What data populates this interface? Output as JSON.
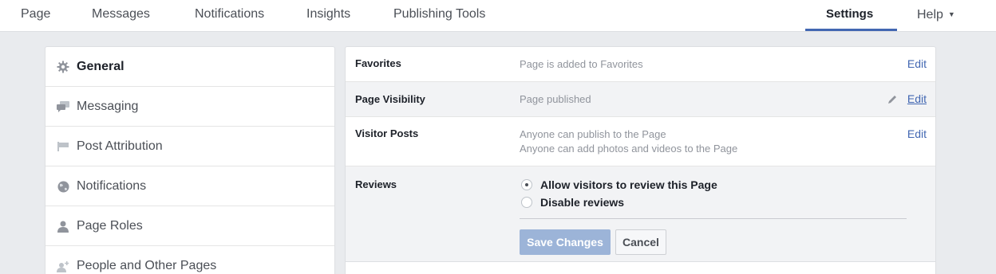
{
  "topnav": {
    "items": [
      "Page",
      "Messages",
      "Notifications",
      "Insights",
      "Publishing Tools"
    ],
    "settings": "Settings",
    "help": "Help",
    "help_caret": "▼",
    "active": "Settings"
  },
  "sidebar": {
    "items": [
      {
        "label": "General",
        "icon": "gear-icon",
        "active": true
      },
      {
        "label": "Messaging",
        "icon": "chat-bubbles-icon"
      },
      {
        "label": "Post Attribution",
        "icon": "flag-icon"
      },
      {
        "label": "Notifications",
        "icon": "globe-icon"
      },
      {
        "label": "Page Roles",
        "icon": "person-icon"
      },
      {
        "label": "People and Other Pages",
        "icon": "person-plus-icon"
      }
    ]
  },
  "settings": {
    "favorites": {
      "label": "Favorites",
      "value": "Page is added to Favorites",
      "edit": "Edit"
    },
    "visibility": {
      "label": "Page Visibility",
      "value": "Page published",
      "edit": "Edit"
    },
    "visitor_posts": {
      "label": "Visitor Posts",
      "value_line1": "Anyone can publish to the Page",
      "value_line2": "Anyone can add photos and videos to the Page",
      "edit": "Edit"
    },
    "reviews": {
      "label": "Reviews",
      "options": [
        "Allow visitors to review this Page",
        "Disable reviews"
      ],
      "selected": "Allow visitors to review this Page",
      "save": "Save Changes",
      "cancel": "Cancel"
    }
  },
  "colors": {
    "accent": "#4267b2",
    "save_button": "#9cb4d8",
    "background": "#e9ebee"
  }
}
